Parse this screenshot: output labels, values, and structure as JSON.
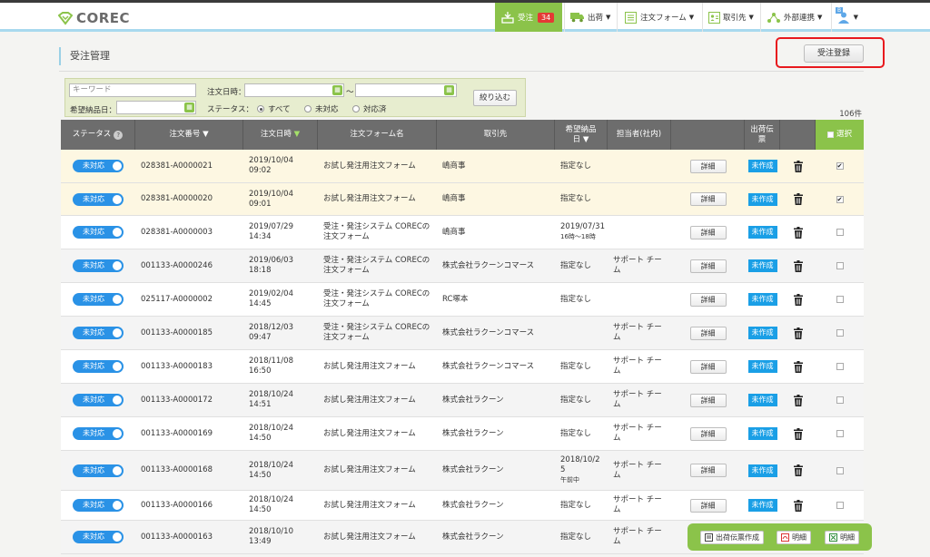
{
  "app": {
    "logo_text": "COREC"
  },
  "nav": {
    "orders": {
      "label": "受注",
      "count": "34"
    },
    "shipping": {
      "label": "出荷"
    },
    "order_form": {
      "label": "注文フォーム"
    },
    "partners": {
      "label": "取引先"
    },
    "integration": {
      "label": "外部連携"
    },
    "user": {
      "badge": "B"
    }
  },
  "page": {
    "title": "受注管理",
    "register_button": "受注登録"
  },
  "search": {
    "keyword_placeholder": "キーワード",
    "order_date_label": "注文日時：",
    "range_sep": "〜",
    "delivery_date_label": "希望納品日：",
    "status_label": "ステータス：",
    "status_options": [
      "すべて",
      "未対応",
      "対応済"
    ],
    "status_selected": "すべて",
    "filter_button": "絞り込む"
  },
  "result_count": "106件",
  "table": {
    "headers": {
      "status": "ステータス",
      "order_no": "注文番号",
      "order_date": "注文日時",
      "form_name": "注文フォーム名",
      "partner": "取引先",
      "delivery_1": "希望納品",
      "delivery_2": "日",
      "staff": "担当者(社内)",
      "slip_1": "出荷伝",
      "slip_2": "票",
      "select": "選択"
    },
    "rows": [
      {
        "status": "未対応",
        "order_no": "028381-A0000021",
        "date1": "2019/10/04",
        "date2": "09:02",
        "form1": "お試し発注用注文フォーム",
        "form2": "",
        "partner": "嶋商事",
        "deliv1": "指定なし",
        "deliv2": "",
        "deliv3": "",
        "staff1": "",
        "staff2": "",
        "detail": "詳細",
        "slip": "未作成",
        "checked": "✔"
      },
      {
        "status": "未対応",
        "order_no": "028381-A0000020",
        "date1": "2019/10/04",
        "date2": "09:01",
        "form1": "お試し発注用注文フォーム",
        "form2": "",
        "partner": "嶋商事",
        "deliv1": "指定なし",
        "deliv2": "",
        "deliv3": "",
        "staff1": "",
        "staff2": "",
        "detail": "詳細",
        "slip": "未作成",
        "checked": "✔"
      },
      {
        "status": "未対応",
        "order_no": "028381-A0000003",
        "date1": "2019/07/29",
        "date2": "14:34",
        "form1": "受注・発注システム CORECの",
        "form2": "注文フォーム",
        "partner": "嶋商事",
        "deliv1": "2019/07/31",
        "deliv2": "16時〜18時",
        "deliv3": "",
        "staff1": "",
        "staff2": "",
        "detail": "詳細",
        "slip": "未作成",
        "checked": ""
      },
      {
        "status": "未対応",
        "order_no": "001133-A0000246",
        "date1": "2019/06/03",
        "date2": "18:18",
        "form1": "受注・発注システム CORECの",
        "form2": "注文フォーム",
        "partner": "株式会社ラクーンコマース",
        "deliv1": "指定なし",
        "deliv2": "",
        "deliv3": "",
        "staff1": "サポート チー",
        "staff2": "ム",
        "detail": "詳細",
        "slip": "未作成",
        "checked": ""
      },
      {
        "status": "未対応",
        "order_no": "025117-A0000002",
        "date1": "2019/02/04",
        "date2": "14:45",
        "form1": "受注・発注システム CORECの",
        "form2": "注文フォーム",
        "partner": "RC塚本",
        "deliv1": "指定なし",
        "deliv2": "",
        "deliv3": "",
        "staff1": "",
        "staff2": "",
        "detail": "詳細",
        "slip": "未作成",
        "checked": ""
      },
      {
        "status": "未対応",
        "order_no": "001133-A0000185",
        "date1": "2018/12/03",
        "date2": "09:47",
        "form1": "受注・発注システム CORECの",
        "form2": "注文フォーム",
        "partner": "株式会社ラクーンコマース",
        "deliv1": "",
        "deliv2": "",
        "deliv3": "",
        "staff1": "サポート チー",
        "staff2": "ム",
        "detail": "詳細",
        "slip": "未作成",
        "checked": ""
      },
      {
        "status": "未対応",
        "order_no": "001133-A0000183",
        "date1": "2018/11/08",
        "date2": "16:50",
        "form1": "お試し発注用注文フォーム",
        "form2": "",
        "partner": "株式会社ラクーンコマース",
        "deliv1": "指定なし",
        "deliv2": "",
        "deliv3": "",
        "staff1": "サポート チー",
        "staff2": "ム",
        "detail": "詳細",
        "slip": "未作成",
        "checked": ""
      },
      {
        "status": "未対応",
        "order_no": "001133-A0000172",
        "date1": "2018/10/24",
        "date2": "14:51",
        "form1": "お試し発注用注文フォーム",
        "form2": "",
        "partner": "株式会社ラクーン",
        "deliv1": "指定なし",
        "deliv2": "",
        "deliv3": "",
        "staff1": "サポート チー",
        "staff2": "ム",
        "detail": "詳細",
        "slip": "未作成",
        "checked": ""
      },
      {
        "status": "未対応",
        "order_no": "001133-A0000169",
        "date1": "2018/10/24",
        "date2": "14:50",
        "form1": "お試し発注用注文フォーム",
        "form2": "",
        "partner": "株式会社ラクーン",
        "deliv1": "指定なし",
        "deliv2": "",
        "deliv3": "",
        "staff1": "サポート チー",
        "staff2": "ム",
        "detail": "詳細",
        "slip": "未作成",
        "checked": ""
      },
      {
        "status": "未対応",
        "order_no": "001133-A0000168",
        "date1": "2018/10/24",
        "date2": "14:50",
        "form1": "お試し発注用注文フォーム",
        "form2": "",
        "partner": "株式会社ラクーン",
        "deliv1": "2018/10/2",
        "deliv2": "5",
        "deliv3": "午前中",
        "staff1": "サポート チー",
        "staff2": "ム",
        "detail": "詳細",
        "slip": "未作成",
        "checked": ""
      },
      {
        "status": "未対応",
        "order_no": "001133-A0000166",
        "date1": "2018/10/24",
        "date2": "14:50",
        "form1": "お試し発注用注文フォーム",
        "form2": "",
        "partner": "株式会社ラクーン",
        "deliv1": "指定なし",
        "deliv2": "",
        "deliv3": "",
        "staff1": "サポート チー",
        "staff2": "ム",
        "detail": "詳細",
        "slip": "未作成",
        "checked": ""
      },
      {
        "status": "未対応",
        "order_no": "001133-A0000163",
        "date1": "2018/10/10",
        "date2": "13:49",
        "form1": "お試し発注用注文フォーム",
        "form2": "",
        "partner": "株式会社ラクーン",
        "deliv1": "指定なし",
        "deliv2": "",
        "deliv3": "",
        "staff1": "サポート チー",
        "staff2": "ム",
        "detail": "詳細",
        "slip": "未作成",
        "checked": ""
      }
    ]
  },
  "float_bar": {
    "create_slip": "出荷伝票作成",
    "statement_1": "明細",
    "statement_2": "明細"
  },
  "colors": {
    "accent_green": "#8bc34a",
    "status_blue": "#2a92e6",
    "slip_blue": "#1a9fe6",
    "badge_red": "#e53935",
    "highlight_red": "#e8191e"
  }
}
